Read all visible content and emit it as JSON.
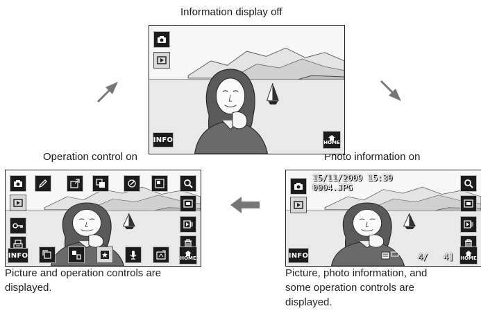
{
  "captions": {
    "top": "Information display off",
    "left": "Operation control on",
    "right": "Photo information on"
  },
  "descriptions": {
    "left_lines": [
      "Picture and operation controls are",
      "displayed."
    ],
    "right_lines": [
      "Picture, photo information, and",
      "some operation controls are",
      "displayed."
    ]
  },
  "buttons": {
    "info_label": "INFO",
    "home_label": "HOME"
  },
  "photo_info": {
    "datetime": "15/11/2009 15:30",
    "filename": "0004.JPG",
    "frame_current": "4/",
    "frame_total": "4]"
  },
  "icons": {
    "left_column": [
      "camera-icon",
      "play-icon"
    ],
    "operation_left_column": [
      "camera-icon",
      "play-icon",
      "protect-icon",
      "print-icon"
    ],
    "operation_top_row": [
      "pencil-icon",
      "retouch-icon",
      "crop-icon",
      "filter-icon",
      "dlighting-icon"
    ],
    "operation_bottom_row": [
      "rotate-icon",
      "small-picture-icon",
      "favorite-icon",
      "voice-memo-icon",
      "slideshow-icon"
    ],
    "right_column": [
      "zoom-icon",
      "thumbnail-icon",
      "sequence-icon",
      "delete-icon"
    ]
  }
}
